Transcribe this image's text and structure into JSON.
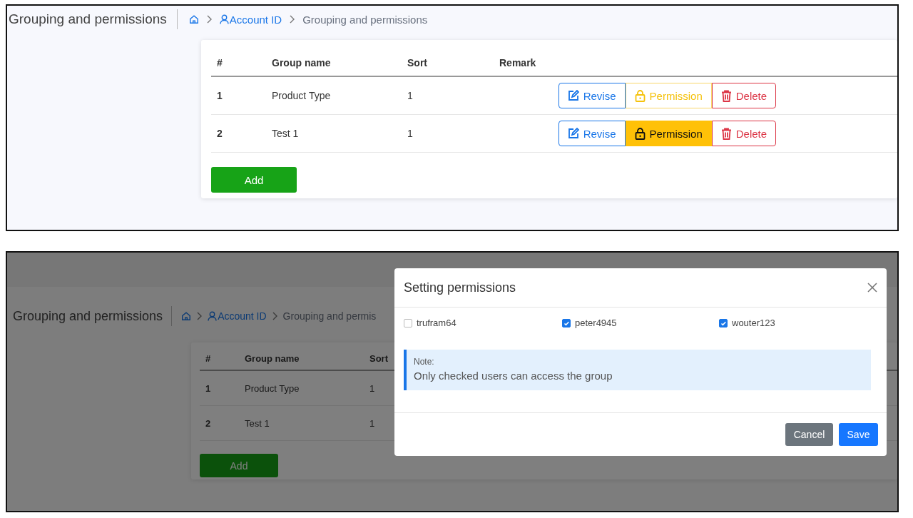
{
  "top": {
    "header": {
      "title": "Grouping and permissions",
      "breadcrumb": {
        "link": "Account ID",
        "current": "Grouping and permissions"
      }
    },
    "table": {
      "columns": [
        "#",
        "Group name",
        "Sort",
        "Remark"
      ],
      "rows": [
        {
          "index": "1",
          "name": "Product Type",
          "sort": "1",
          "actions": {
            "revise": "Revise",
            "permission": "Permission",
            "permission_selected": false,
            "delete": "Delete"
          }
        },
        {
          "index": "2",
          "name": "Test 1",
          "sort": "1",
          "actions": {
            "revise": "Revise",
            "permission": "Permission",
            "permission_selected": true,
            "delete": "Delete"
          }
        }
      ]
    },
    "add_button": "Add"
  },
  "bottom": {
    "page": {
      "header": {
        "title": "Grouping and permissions",
        "breadcrumb": {
          "link": "Account ID",
          "current": "Grouping and permis"
        }
      },
      "table": {
        "columns": [
          "#",
          "Group name",
          "Sort"
        ],
        "rows": [
          {
            "index": "1",
            "name": "Product Type",
            "sort": "1"
          },
          {
            "index": "2",
            "name": "Test 1",
            "sort": "1"
          }
        ]
      },
      "add_button": "Add"
    },
    "dialog": {
      "title": "Setting permissions",
      "users": [
        {
          "name": "trufram64",
          "checked": false
        },
        {
          "name": "peter4945",
          "checked": true
        },
        {
          "name": "wouter123",
          "checked": true
        }
      ],
      "note": {
        "label": "Note:",
        "text": "Only checked users can access the group"
      },
      "buttons": {
        "cancel": "Cancel",
        "save": "Save"
      }
    }
  }
}
